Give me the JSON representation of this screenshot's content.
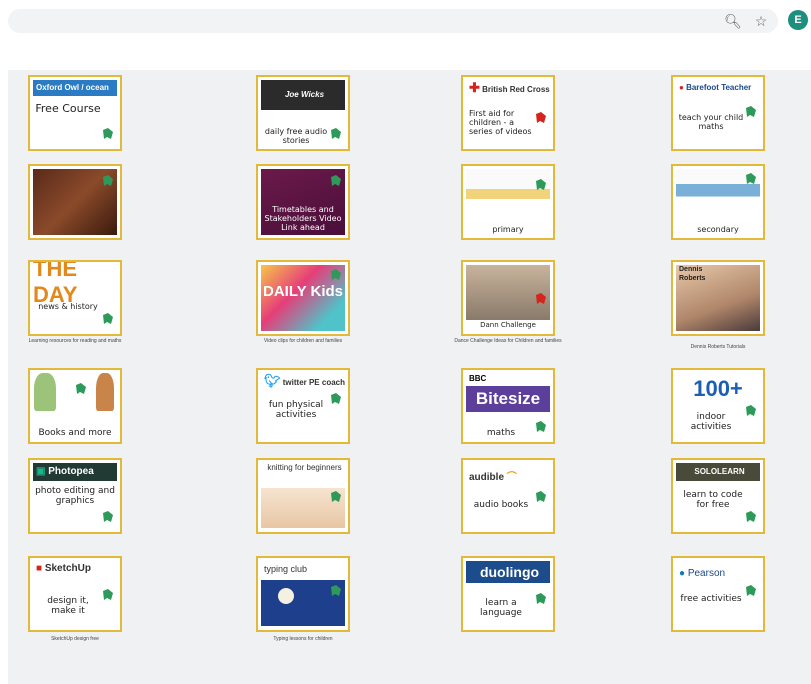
{
  "toolbar": {
    "zoom_icon": "magnifier-icon",
    "star_icon": "star-icon",
    "profile_initial": "E"
  },
  "tiles": [
    {
      "head": "Oxford Owl / ocean",
      "body": "Free Course"
    },
    {
      "head": "Joe Wicks",
      "body": "daily free audio stories"
    },
    {
      "head": "British Red Cross",
      "body": "First aid for children - a series of videos"
    },
    {
      "head": "Barefoot Teacher",
      "body": "teach your child maths"
    },
    {
      "body": ""
    },
    {
      "body": "Timetables and Stakeholders Video Link ahead"
    },
    {
      "body": "primary"
    },
    {
      "body": "secondary"
    },
    {
      "head": "THE DAY",
      "body": "news & history"
    },
    {
      "head": "DAILY Kids",
      "body": ""
    },
    {
      "body": "Dann Challenge"
    },
    {
      "head": "Dennis Roberts",
      "body": ""
    },
    {
      "body": "Books and more"
    },
    {
      "head": "twitter PE coach",
      "body": "fun physical activities"
    },
    {
      "head": "BBC",
      "bigtext": "Bitesize",
      "body": "maths"
    },
    {
      "head": "100+",
      "body": "indoor activities"
    },
    {
      "head": "Photopea",
      "body": "photo editing and graphics"
    },
    {
      "head": "knitting for beginners",
      "body": ""
    },
    {
      "head": "audible",
      "body": "audio books"
    },
    {
      "head": "SOLOLEARN",
      "body": "learn to code for free"
    },
    {
      "head": "SketchUp",
      "body": "design it, make it"
    },
    {
      "head": "typing club",
      "body": ""
    },
    {
      "head": "duolingo",
      "body": "learn a language"
    },
    {
      "head": "Pearson",
      "body": "free activities"
    }
  ],
  "captions": {
    "c1": "Learning resources for reading and maths",
    "c2": "Video clips for children and families",
    "c3": "Dance Challenge Ideas for Children and families",
    "c4": "Dennis Roberts Tutorials",
    "c5": "SketchUp design free",
    "c6": "Typing lessons for children"
  },
  "colors": {
    "tile_border": "#e3b93a",
    "green_accent": "#2e9a5a",
    "background": "#f0f1f2"
  }
}
